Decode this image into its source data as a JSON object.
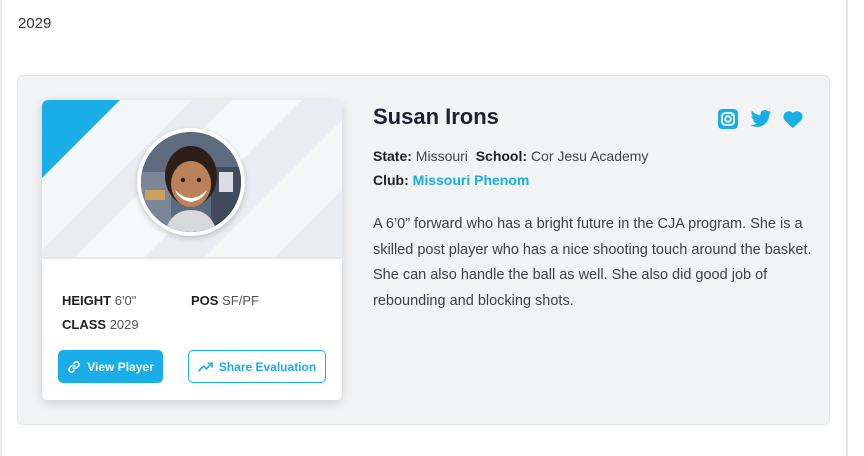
{
  "year_heading": "2029",
  "player": {
    "name": "Susan Irons",
    "state_label": "State:",
    "state": "Missouri",
    "school_label": "School:",
    "school": "Cor Jesu Academy",
    "club_label": "Club:",
    "club": "Missouri Phenom",
    "bio": "A 6’0” forward who has a bright future in the CJA program. She is a skilled post player who has a nice shooting touch around the basket. She can also handle the ball as well. She also did good job of rebounding and blocking shots."
  },
  "stats": {
    "height_label": "HEIGHT",
    "height": "6'0\"",
    "pos_label": "POS",
    "pos": "SF/PF",
    "class_label": "CLASS",
    "class": "2029"
  },
  "buttons": {
    "view_player": "View Player",
    "share_evaluation": "Share Evaluation"
  },
  "icons": {
    "social": [
      "instagram-icon",
      "twitter-icon",
      "heart-icon"
    ],
    "view": "link-icon",
    "share": "trend-up-icon"
  },
  "colors": {
    "accent": "#19aee8",
    "section_bg": "#f2f3f5"
  }
}
